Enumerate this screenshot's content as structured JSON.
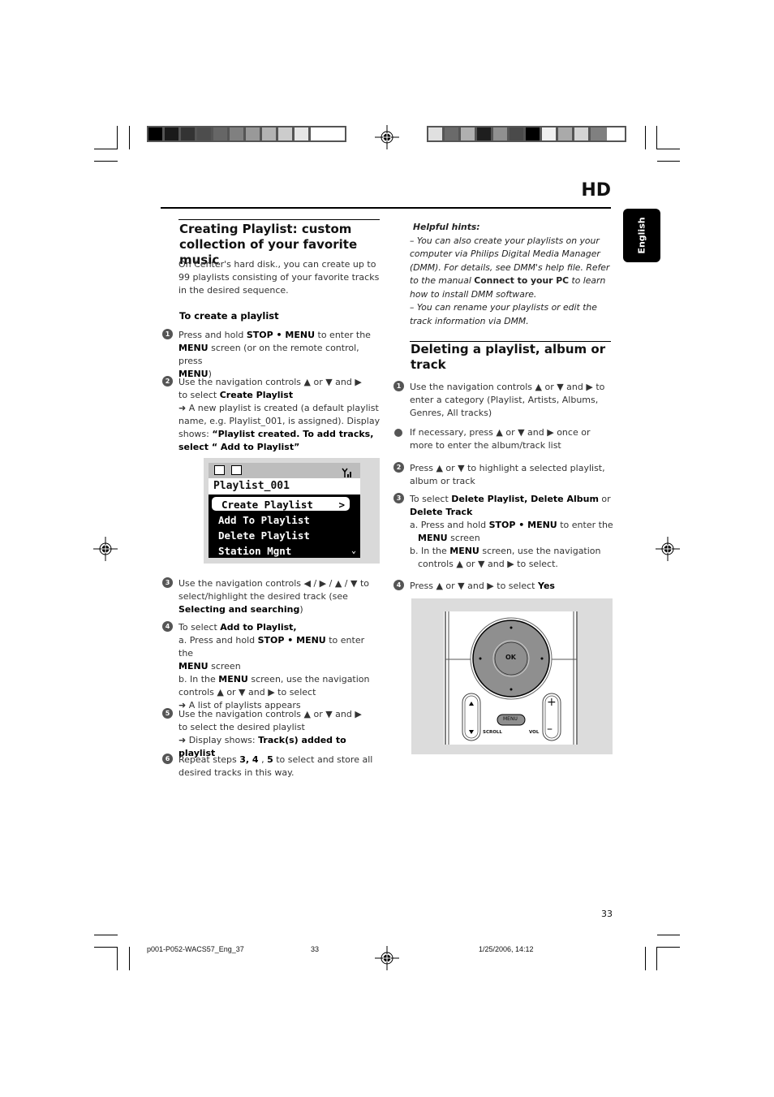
{
  "header": {
    "section_code": "HD",
    "language_tab": "English"
  },
  "left_column": {
    "title_line1": "Creating Playlist:  custom",
    "title_line2": "collection of your favorite music",
    "intro": "On Center's hard disk., you can create up to 99 playlists consisting of your favorite tracks in the desired sequence.",
    "subheading": "To create a playlist",
    "steps": [
      {
        "number": "1",
        "html_parts": [
          "Press and hold ",
          "STOP • MENU",
          " to enter the ",
          "MENU",
          " screen (or on the remote control, press ",
          "MENU",
          ")"
        ]
      },
      {
        "number": "2",
        "line1": "Use the navigation controls ▲ or ▼ and ▶",
        "line2_pre": "to select ",
        "line2_bold": "Create Playlist",
        "result": "➜ A new playlist is created (a default playlist name, e.g. Playlist_001, is assigned). Display shows: ",
        "result_bold": "“Playlist created. To add tracks, select “ Add to Playlist”"
      },
      {
        "number": "3",
        "pre": "Use the navigation controls ◀ / ▶ / ▲ / ▼ to select/highlight the desired track (see ",
        "bold": "Selecting and searching",
        "post": ")"
      },
      {
        "number": "4",
        "pre": "To select ",
        "bold": "Add to Playlist,",
        "a_pre": "a. Press and hold ",
        "a_bold1": "STOP • MENU",
        "a_mid": " to enter the ",
        "a_bold2": "MENU",
        "a_post": " screen",
        "b_pre": "b. In the ",
        "b_bold": "MENU",
        "b_post": " screen, use the navigation",
        "b_line2": "controls ▲ or ▼ and ▶ to select",
        "result": "➜ A list of playlists appears"
      },
      {
        "number": "5",
        "line1": "Use the navigation controls ▲ or ▼ and ▶",
        "line2": "to select the desired playlist",
        "result_pre": "➜ Display shows: ",
        "result_bold": "Track(s) added to playlist"
      },
      {
        "number": "6",
        "pre": "Repeat steps ",
        "bold": "3, 4",
        "mid": " , ",
        "bold2": "5",
        "post": " to select and store all desired tracks in this way."
      }
    ]
  },
  "lcd_screen": {
    "title": "Playlist_001",
    "menu_items": [
      "Create Playlist",
      "Add To Playlist",
      "Delete Playlist",
      "Station Mgnt"
    ],
    "selected_index": 0,
    "selected_arrow": ">",
    "more_arrow": "⌄"
  },
  "right_column": {
    "hints_title": "Helpful hints:",
    "hint1_pre": "–  You can also create your playlists on your computer via Philips Digital Media Manager (DMM). For details, see DMM's help file. Refer to the manual ",
    "hint1_bold": "Connect to your PC",
    "hint1_post": " to learn how to install DMM software.",
    "hint2": "– You can rename your playlists or edit the track information via DMM.",
    "title_line1": "Deleting a playlist, album or",
    "title_line2": "track",
    "steps": [
      {
        "number": "1",
        "text": "Use the navigation controls ▲ or ▼ and ▶ to enter a category (Playlist, Artists, Albums, Genres, All tracks)"
      },
      {
        "number": "•",
        "text": "If necessary,  press ▲ or ▼ and ▶ once or more to enter the album/track list"
      },
      {
        "number": "2",
        "text": "Press ▲ or ▼  to highlight a selected playlist, album or track"
      },
      {
        "number": "3",
        "pre": "To select ",
        "bold": "Delete Playlist, Delete Album",
        "mid": " or ",
        "bold2": "Delete Track",
        "a_pre": "a. Press and hold ",
        "a_bold1": "STOP • MENU",
        "a_mid": " to enter the",
        "a_bold2": "MENU",
        "a_post": " screen",
        "b_pre": "b. In the ",
        "b_bold": "MENU",
        "b_post": " screen, use the navigation",
        "b_line2": "controls ▲ or ▼ and ▶ to select."
      },
      {
        "number": "4",
        "pre": "Press ▲ or ▼ and ▶ to select ",
        "bold": "Yes"
      }
    ]
  },
  "remote_image": {
    "center_label": "OK",
    "menu_label": "MENU",
    "scroll_label": "SCROLL",
    "vol_label": "VOL",
    "plus": "+",
    "minus": "–"
  },
  "footer": {
    "page_number": "33",
    "file_name": "p001-P052-WACS57_Eng_37",
    "file_page": "33",
    "timestamp": "1/25/2006, 14:12"
  },
  "color_bars": {
    "left": [
      "#000000",
      "#1a1a1a",
      "#333333",
      "#4d4d4d",
      "#666666",
      "#808080",
      "#999999",
      "#b3b3b3",
      "#cccccc",
      "#e6e6e6",
      "#ffffff"
    ],
    "right": [
      "#e0e0e0",
      "#6a6a6a",
      "#b0b0b0",
      "#1e1e1e",
      "#909090",
      "#4a4a4a",
      "#000000",
      "#f0f0f0",
      "#aaaaaa",
      "#d4d4d4",
      "#808080"
    ]
  }
}
